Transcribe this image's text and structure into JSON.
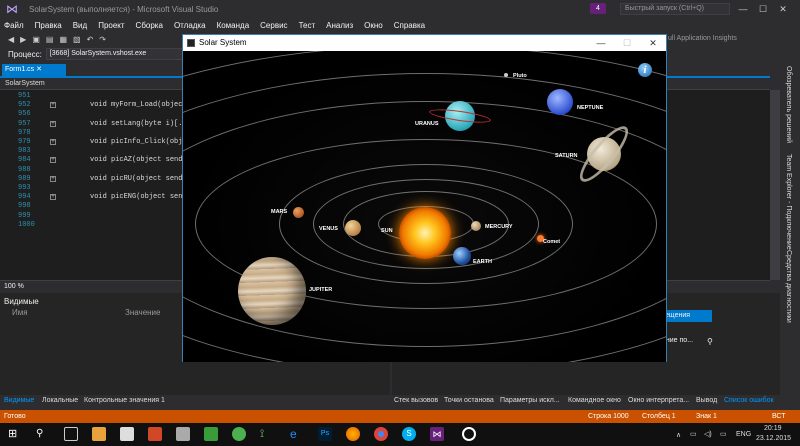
{
  "window": {
    "title": "SolarSystem (выполняется) - Microsoft Visual Studio",
    "notification_count": "4",
    "quick_launch_placeholder": "Быстрый запуск (Ctrl+Q)"
  },
  "menu": [
    "Файл",
    "Правка",
    "Вид",
    "Проект",
    "Сборка",
    "Отладка",
    "Команда",
    "Сервис",
    "Тест",
    "Анализ",
    "Окно",
    "Справка"
  ],
  "toolbar": {
    "process_label": "Процесс:",
    "process_value": "[3668] SolarSystem.vshost.exe",
    "app_insights": "ull Application Insights"
  },
  "editor": {
    "tab_label": "Form1.cs",
    "nav_label": "SolarSystem",
    "line_numbers": [
      "951",
      "952",
      "956",
      "957",
      "978",
      "979",
      "983",
      "984",
      "988",
      "989",
      "993",
      "994",
      "998",
      "999",
      "1000"
    ],
    "code_lines": [
      {
        "line": "952",
        "text": "void myForm_Load(object"
      },
      {
        "line": "957",
        "text": "void setLang(byte i)[...]"
      },
      {
        "line": "979",
        "text": "void picInfo_Click(obje"
      },
      {
        "line": "984",
        "text": "void picAZ(object sende"
      },
      {
        "line": "989",
        "text": "void picRU(object sende"
      },
      {
        "line": "994",
        "text": "void picENG(object sende"
      }
    ],
    "zoom": "100 %"
  },
  "sidebar_tabs": [
    "Обозреватель решений",
    "Team Explorer - Подключение",
    "Средства диагностики"
  ],
  "locals_panel": {
    "title": "Видимые",
    "col_name": "Имя",
    "col_value": "Значение"
  },
  "right_panel": {
    "tab_fragment": "ещения",
    "row_fragment": "ение по..."
  },
  "bottom_tabs_left": [
    "Видимые",
    "Локальные",
    "Контрольные значения 1"
  ],
  "bottom_tabs_right": [
    "Стек вызовов",
    "Точки останова",
    "Параметры искл...",
    "Командное окно",
    "Окно интерпрета...",
    "Вывод",
    "Список ошибок"
  ],
  "status": {
    "ready": "Готово",
    "line": "Строка 1000",
    "column": "Столбец 1",
    "char": "Знак 1",
    "mode": "ВСТ"
  },
  "solar_window": {
    "title": "Solar System",
    "info_glyph": "i",
    "labels": {
      "sun": "SUN",
      "mercury": "MERCURY",
      "venus": "VENUS",
      "earth": "EARTH",
      "mars": "MARS",
      "jupiter": "JUPITER",
      "saturn": "SATURN",
      "uranus": "URANUS",
      "neptune": "NEPTUNE",
      "pluto": "Pluto",
      "comet": "Comet"
    }
  },
  "taskbar": {
    "lang": "ENG",
    "time": "20:19",
    "date": "23.12.2015"
  },
  "colors": {
    "accent": "#007acc",
    "status_bar": "#ca5100",
    "vs_purple": "#68217a"
  }
}
